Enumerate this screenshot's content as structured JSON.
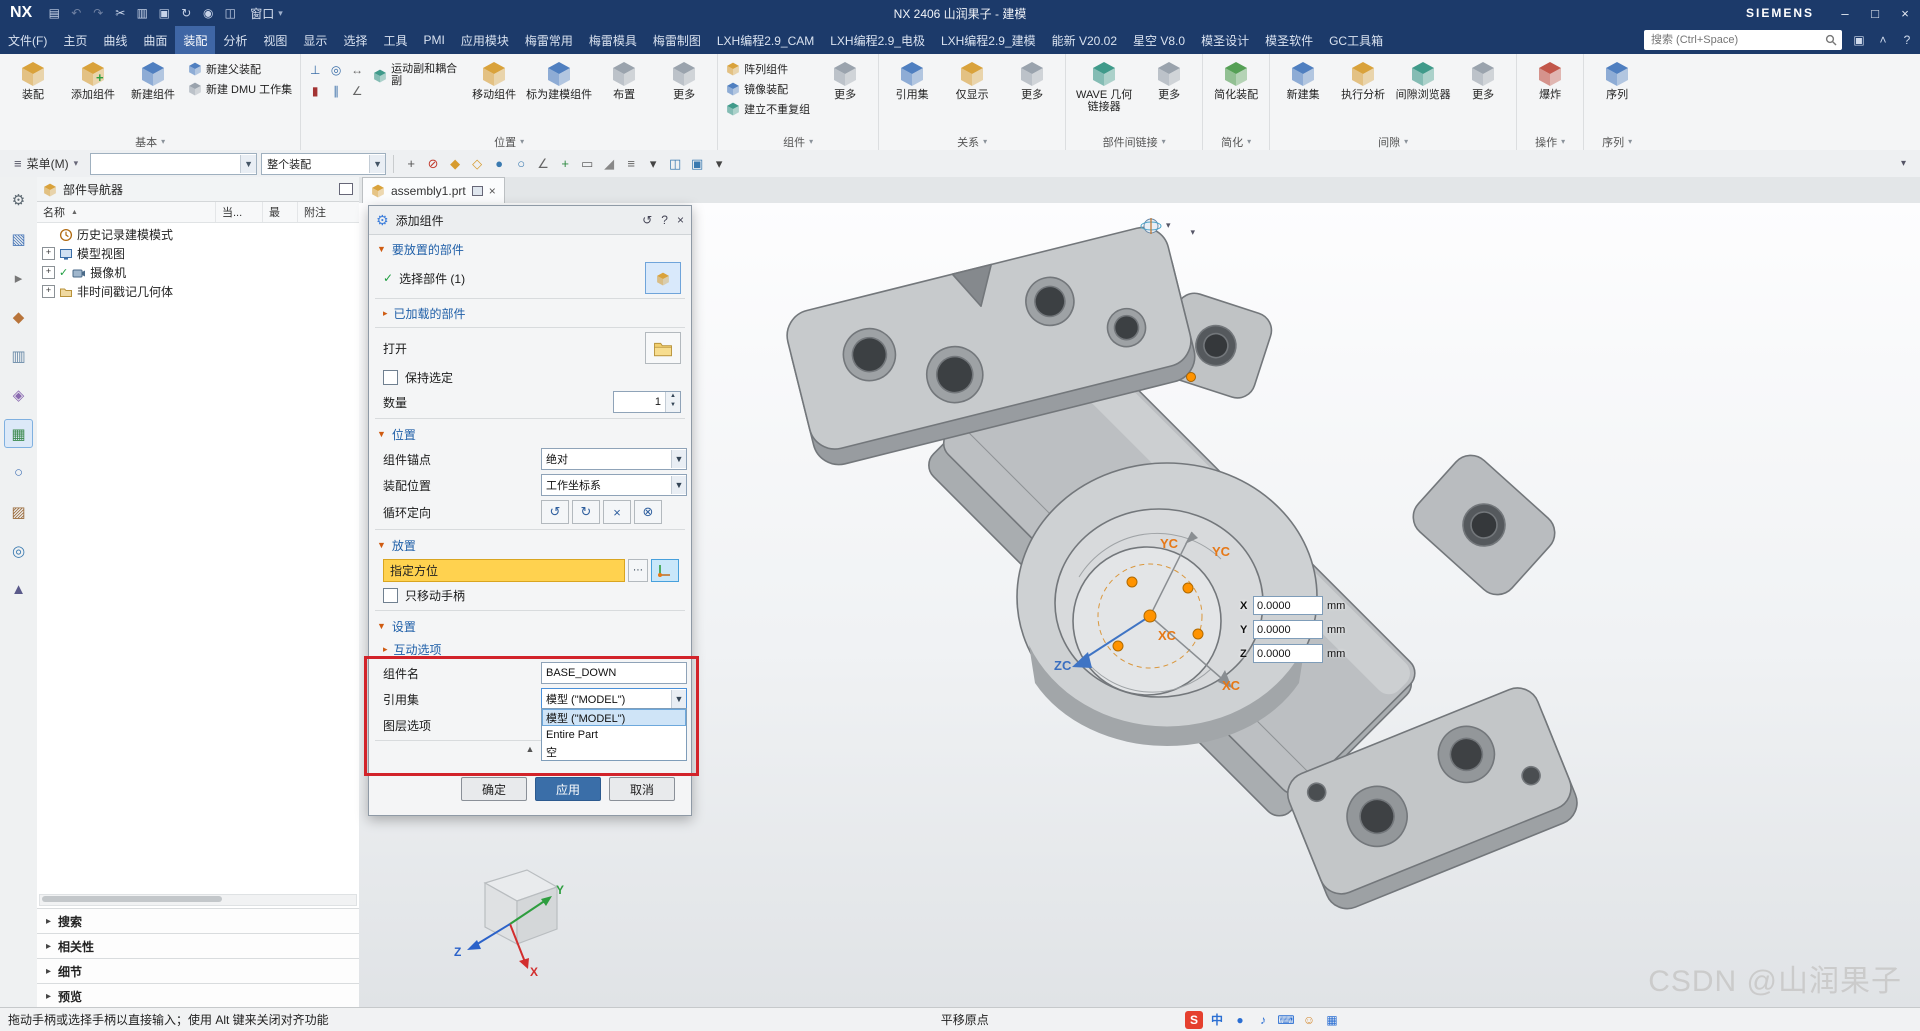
{
  "title_bar": {
    "app_logo": "NX",
    "title": "NX 2406 山润果子 - 建模",
    "brand": "SIEMENS",
    "window_label": "窗口",
    "quick_icons": [
      {
        "name": "save-icon",
        "glyph": "▤",
        "cls": ""
      },
      {
        "name": "undo-icon",
        "glyph": "↶",
        "cls": "dim"
      },
      {
        "name": "redo-icon",
        "glyph": "↷",
        "cls": "dim"
      },
      {
        "name": "cut-icon",
        "glyph": "✂",
        "cls": ""
      },
      {
        "name": "copy-icon",
        "glyph": "▥",
        "cls": ""
      },
      {
        "name": "paste-icon",
        "glyph": "▣",
        "cls": ""
      },
      {
        "name": "repeat-command-icon",
        "glyph": "↻",
        "cls": ""
      },
      {
        "name": "touch-mode-icon",
        "glyph": "◉",
        "cls": ""
      },
      {
        "name": "window-split-icon",
        "glyph": "◫",
        "cls": ""
      }
    ]
  },
  "menu": {
    "search_placeholder": "搜索 (Ctrl+Space)",
    "tabs": [
      {
        "label": "文件(F)"
      },
      {
        "label": "主页"
      },
      {
        "label": "曲线"
      },
      {
        "label": "曲面"
      },
      {
        "label": "装配",
        "cls": "active"
      },
      {
        "label": "分析"
      },
      {
        "label": "视图"
      },
      {
        "label": "显示"
      },
      {
        "label": "选择"
      },
      {
        "label": "工具"
      },
      {
        "label": "PMI"
      },
      {
        "label": "应用模块"
      },
      {
        "label": "梅雷常用"
      },
      {
        "label": "梅雷模具"
      },
      {
        "label": "梅雷制图"
      },
      {
        "label": "LXH编程2.9_CAM"
      },
      {
        "label": "LXH编程2.9_电极"
      },
      {
        "label": "LXH编程2.9_建模"
      },
      {
        "label": "能新 V20.02"
      },
      {
        "label": "星空 V8.0"
      },
      {
        "label": "模圣设计"
      },
      {
        "label": "模圣软件"
      },
      {
        "label": "GC工具箱"
      }
    ]
  },
  "ribbon": {
    "groups": {
      "basic": "基本",
      "position": "位置",
      "component": "组件",
      "relation": "关系",
      "interpart": "部件间链接",
      "simplify": "简化",
      "clearance": "间隙",
      "operation": "操作",
      "sequence": "序列"
    },
    "more": "更多",
    "assembly": "装配",
    "add_component": "添加组件",
    "new_component": "新建组件",
    "new_parent": "新建父装配",
    "new_dmu": "新建 DMU 工作集",
    "joint": "运动副和耦合副",
    "move_component": "移动组件",
    "mark_modeling": "标为建模组件",
    "arrangements": "布置",
    "pattern": "阵列组件",
    "mirror": "镜像装配",
    "unique_group": "建立不重复组",
    "refsets": "引用集",
    "show_only": "仅显示",
    "wave": "WAVE 几何链接器",
    "simplify_assembly": "简化装配",
    "new_set": "新建集",
    "perform_analysis": "执行分析",
    "clearance_browser": "间隙浏览器",
    "explode": "爆炸",
    "sequence": "序列",
    "constraint_icons": [
      {
        "name": "touch-align-icon",
        "glyph": "⊥",
        "color": "#3a6ea8"
      },
      {
        "name": "concentric-icon",
        "glyph": "◎",
        "color": "#3a6ea8"
      },
      {
        "name": "distance-icon",
        "glyph": "↔",
        "color": "#666666"
      },
      {
        "name": "fix-icon",
        "glyph": "▮",
        "color": "#a33333"
      },
      {
        "name": "parallel-icon",
        "glyph": "∥",
        "color": "#3a6ea8"
      },
      {
        "name": "angle-icon",
        "glyph": "∠",
        "color": "#666666"
      }
    ]
  },
  "toolbar2": {
    "menu_label": "菜单(M)",
    "filter_value": "",
    "scope_value": "整个装配",
    "icons": [
      {
        "name": "snap-point-icon",
        "glyph": "+",
        "color": "#555555"
      },
      {
        "name": "no-selection-filter-icon",
        "glyph": "⊘",
        "color": "#c23b2e"
      },
      {
        "name": "midpoint-snap-icon",
        "glyph": "◆",
        "color": "#d79b2e"
      },
      {
        "name": "endpoint-snap-icon",
        "glyph": "◇",
        "color": "#d79b2e"
      },
      {
        "name": "center-snap-icon",
        "glyph": "●",
        "color": "#3a7ab0"
      },
      {
        "name": "circle-snap-icon",
        "glyph": "○",
        "color": "#3a7ab0"
      },
      {
        "name": "angle-snap-icon",
        "glyph": "∠",
        "color": "#666666"
      },
      {
        "name": "intersection-snap-icon",
        "glyph": "+",
        "color": "#2e8a42"
      },
      {
        "name": "face-snap-icon",
        "glyph": "▭",
        "color": "#666666"
      },
      {
        "name": "triangle-snap-icon",
        "glyph": "◢",
        "color": "#888888"
      },
      {
        "name": "snap-list-icon",
        "glyph": "≡",
        "color": "#666666"
      },
      {
        "name": "more-snaps-icon",
        "glyph": "▾",
        "color": "#444444"
      },
      {
        "name": "component-select-icon",
        "glyph": "◫",
        "color": "#3a7ab0"
      },
      {
        "name": "body-select-icon",
        "glyph": "▣",
        "color": "#3a7ab0"
      },
      {
        "name": "scope-more-icon",
        "glyph": "▾",
        "color": "#444444"
      }
    ]
  },
  "resource_bar": {
    "icons": [
      {
        "name": "role-icon",
        "glyph": "⚙",
        "color": "#5b6770"
      },
      {
        "name": "assembly-navigator-icon",
        "glyph": "▧",
        "color": "#4a78b8"
      },
      {
        "name": "selection-icon",
        "glyph": "▸",
        "color": "#777777"
      },
      {
        "name": "palette-icon",
        "glyph": "◆",
        "color": "#b8743a"
      },
      {
        "name": "reuse-library-icon",
        "glyph": "▥",
        "color": "#6a8aa8"
      },
      {
        "name": "tools-icon",
        "glyph": "◈",
        "color": "#8a6ab0"
      },
      {
        "name": "part-navigator-icon",
        "glyph": "▦",
        "color": "#3c8a4e",
        "cls": "active"
      },
      {
        "name": "history-icon",
        "glyph": "○",
        "color": "#4a78b8"
      },
      {
        "name": "process-icon",
        "glyph": "▨",
        "color": "#9a6a3a"
      },
      {
        "name": "web-browser-icon",
        "glyph": "◎",
        "color": "#3a7ab0"
      },
      {
        "name": "touch-icon",
        "glyph": "▲",
        "color": "#5a5a8a"
      }
    ]
  },
  "navigator": {
    "title": "部件导航器",
    "columns": [
      "名称",
      "当...",
      "最",
      "附注"
    ],
    "rows": [
      {
        "label": "历史记录建模模式"
      },
      {
        "label": "模型视图"
      },
      {
        "label": "摄像机",
        "checked": true
      },
      {
        "label": "非时间戳记几何体"
      }
    ],
    "sections": [
      "搜索",
      "相关性",
      "细节",
      "预览"
    ]
  },
  "viewport": {
    "tab_label": "assembly1.prt",
    "watermark": "CSDN @山润果子",
    "axis_labels": {
      "xc": "XC",
      "yc": "YC",
      "zc": "ZC"
    },
    "triad": {
      "x": "X",
      "y": "Y",
      "z": "Z"
    },
    "coords": [
      {
        "axis": "X",
        "value": "0.0000",
        "unit": "mm"
      },
      {
        "axis": "Y",
        "value": "0.0000",
        "unit": "mm"
      },
      {
        "axis": "Z",
        "value": "0.0000",
        "unit": "mm"
      }
    ]
  },
  "dialog": {
    "title": "添加组件",
    "sec_part": "要放置的部件",
    "select_part": "选择部件 (1)",
    "sec_loaded": "已加载的部件",
    "open_label": "打开",
    "keep_selected": "保持选定",
    "quantity_label": "数量",
    "quantity_value": "1",
    "sec_position": "位置",
    "anchor_label": "组件锚点",
    "anchor_value": "绝对",
    "asmpos_label": "装配位置",
    "asmpos_value": "工作坐标系",
    "cycle_label": "循环定向",
    "sec_placement": "放置",
    "orient_label": "指定方位",
    "move_handles": "只移动手柄",
    "sec_settings": "设置",
    "interaction": "互动选项",
    "name_label": "组件名",
    "name_value": "BASE_DOWN",
    "refset_label": "引用集",
    "refset_value": "模型 (\"MODEL\")",
    "layer_label": "图层选项",
    "dropdown": [
      {
        "label": "模型 (\"MODEL\")",
        "cls": "hl"
      },
      {
        "label": "Entire Part"
      },
      {
        "label": "空"
      }
    ],
    "ok": "确定",
    "apply": "应用",
    "cancel": "取消"
  },
  "statusbar": {
    "hint": "拖动手柄或选择手柄以直接输入；使用 Alt 键来关闭对齐功能",
    "center": "平移原点",
    "icons": [
      {
        "name": "sogou-input-icon",
        "glyph": "S",
        "color": "#ffffff",
        "bg": "#e5402e"
      },
      {
        "name": "chinese-english-toggle-icon",
        "glyph": "中",
        "color": "#2b6fd3"
      },
      {
        "name": "fullwidth-toggle-icon",
        "glyph": "●",
        "color": "#2b6fd3"
      },
      {
        "name": "voice-input-icon",
        "glyph": "♪",
        "color": "#2b6fd3"
      },
      {
        "name": "keyboard-icon",
        "glyph": "⌨",
        "color": "#2b6fd3"
      },
      {
        "name": "emoji-icon",
        "glyph": "☺",
        "color": "#d4872a"
      },
      {
        "name": "toolbox-icon",
        "glyph": "▦",
        "color": "#2b6fd3"
      }
    ]
  }
}
